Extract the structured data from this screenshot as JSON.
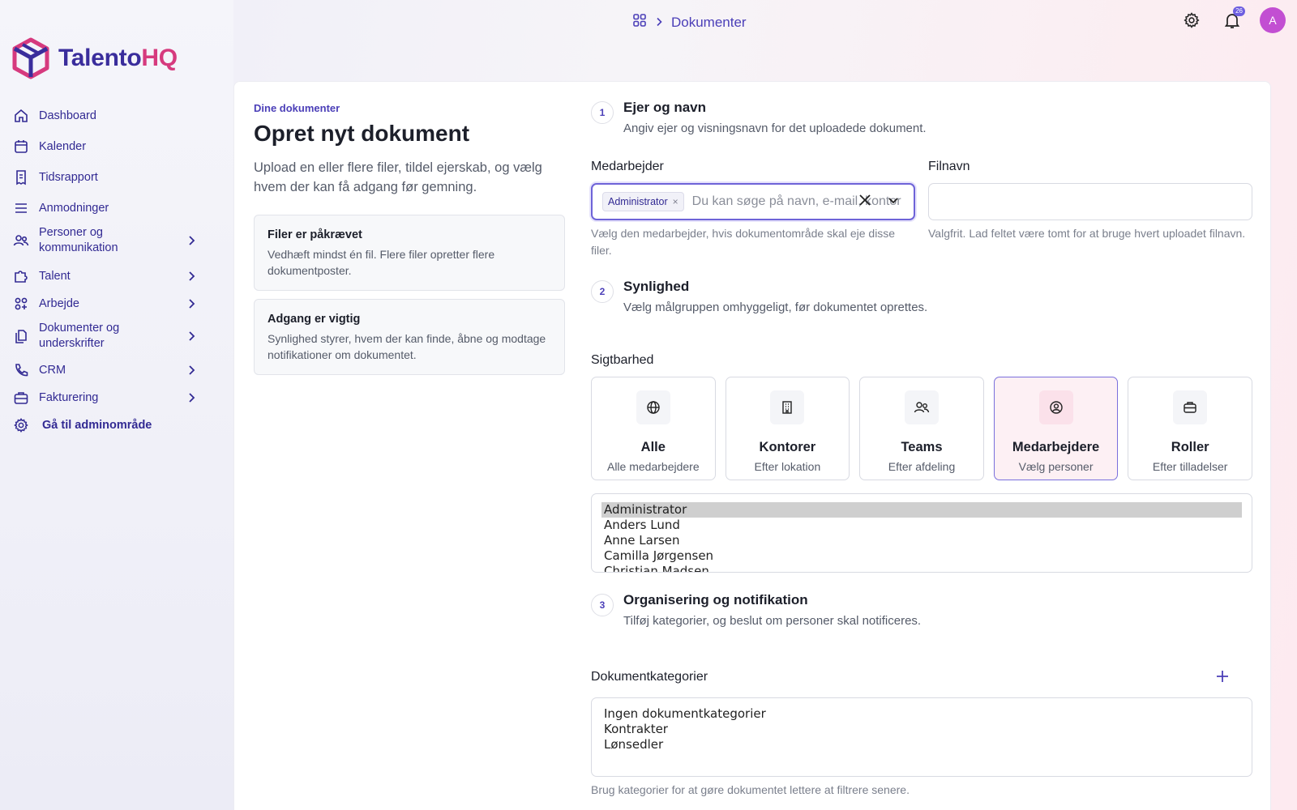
{
  "header": {
    "breadcrumb_current": "Dokumenter",
    "notification_count": "26",
    "avatar_initial": "A"
  },
  "brand": {
    "part1": "Talento",
    "part2": "HQ"
  },
  "sidebar": {
    "items": [
      {
        "label": "Dashboard",
        "icon": "home-icon",
        "has_children": false
      },
      {
        "label": "Kalender",
        "icon": "calendar-icon",
        "has_children": false
      },
      {
        "label": "Tidsrapport",
        "icon": "receipt-icon",
        "has_children": false
      },
      {
        "label": "Anmodninger",
        "icon": "list-icon",
        "has_children": false
      },
      {
        "label": "Personer og kommunikation",
        "icon": "users-icon",
        "has_children": true
      },
      {
        "label": "Talent",
        "icon": "puzzle-icon",
        "has_children": true
      },
      {
        "label": "Arbejde",
        "icon": "apps-icon",
        "has_children": true
      },
      {
        "label": "Dokumenter og underskrifter",
        "icon": "documents-icon",
        "has_children": true
      },
      {
        "label": "CRM",
        "icon": "phone-icon",
        "has_children": true
      },
      {
        "label": "Fakturering",
        "icon": "briefcase-icon",
        "has_children": true
      },
      {
        "label": "Gå til adminområde",
        "icon": "gear-icon",
        "has_children": false
      }
    ]
  },
  "intro": {
    "eyebrow": "Dine dokumenter",
    "title": "Opret nyt dokument",
    "description": "Upload en eller flere filer, tildel ejerskab, og vælg hvem der kan få adgang før gemning.",
    "notes": [
      {
        "title": "Filer er påkrævet",
        "text": "Vedhæft mindst én fil. Flere filer opretter flere dokumentposter."
      },
      {
        "title": "Adgang er vigtig",
        "text": "Synlighed styrer, hvem der kan finde, åbne og modtage notifikationer om dokumentet."
      }
    ]
  },
  "step1": {
    "number": "1",
    "title": "Ejer og navn",
    "description": "Angiv ejer og visningsnavn for det uploadede dokument.",
    "employee_label": "Medarbejder",
    "employee_chip": "Administrator",
    "employee_placeholder": "Du kan søge på navn, e-mail, kontor",
    "employee_help": "Vælg den medarbejder, hvis dokumentområde skal eje disse filer.",
    "filename_label": "Filnavn",
    "filename_value": "",
    "filename_help": "Valgfrit. Lad feltet være tomt for at bruge hvert uploadet filnavn."
  },
  "step2": {
    "number": "2",
    "title": "Synlighed",
    "description": "Vælg målgruppen omhyggeligt, før dokumentet oprettes.",
    "visibility_label": "Sigtbarhed",
    "options": [
      {
        "title": "Alle",
        "subtitle": "Alle medarbejdere",
        "icon": "globe-icon",
        "selected": false
      },
      {
        "title": "Kontorer",
        "subtitle": "Efter lokation",
        "icon": "building-icon",
        "selected": false
      },
      {
        "title": "Teams",
        "subtitle": "Efter afdeling",
        "icon": "team-icon",
        "selected": false
      },
      {
        "title": "Medarbejdere",
        "subtitle": "Vælg personer",
        "icon": "user-circle-icon",
        "selected": true
      },
      {
        "title": "Roller",
        "subtitle": "Efter tilladelser",
        "icon": "briefcase-icon",
        "selected": false
      }
    ],
    "employee_list": [
      "Administrator",
      "Anders Lund",
      "Anne Larsen",
      "Camilla Jørgensen",
      "Christian Madsen"
    ],
    "selected_employee": "Administrator"
  },
  "step3": {
    "number": "3",
    "title": "Organisering og notifikation",
    "description": "Tilføj kategorier, og beslut om personer skal notificeres.",
    "categories_label": "Dokumentkategorier",
    "categories": [
      "Ingen dokumentkategorier",
      "Kontrakter",
      "Lønsedler"
    ],
    "categories_help": "Brug kategorier for at gøre dokumentet lettere at filtrere senere."
  },
  "colors": {
    "accent": "#4b3fb8",
    "brand_pink": "#d63a7e",
    "selected_card_bg": "#fdf0f4"
  }
}
